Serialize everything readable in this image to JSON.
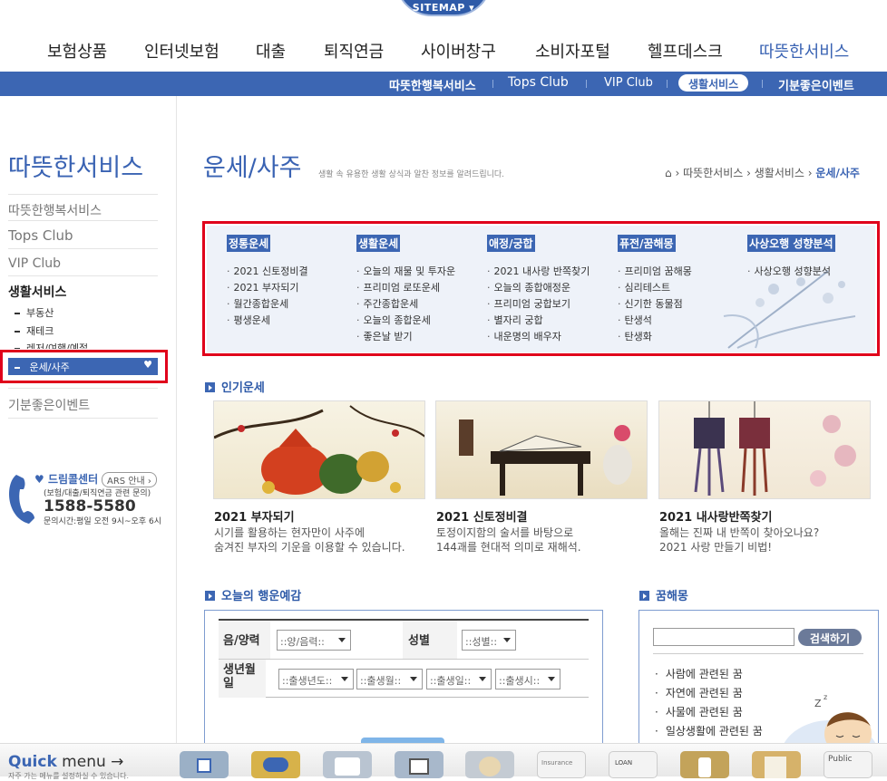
{
  "sitemap": "SITEMAP ▾",
  "gnb": [
    "보험상품",
    "인터넷보험",
    "대출",
    "퇴직연금",
    "사이버창구",
    "소비자포털",
    "헬프데스크",
    "따뜻한서비스"
  ],
  "subnav": [
    "따뜻한행복서비스",
    "Tops Club",
    "VIP Club",
    "생활서비스",
    "기분좋은이벤트"
  ],
  "lnb": {
    "title": "따뜻한서비스",
    "items": [
      "따뜻한행복서비스",
      "Tops Club",
      "VIP Club",
      "생활서비스"
    ],
    "subitems": [
      "부동산",
      "재테크",
      "레저/여행/예절"
    ],
    "active": "운세/사주",
    "last": "기분좋은이벤트"
  },
  "callcenter": {
    "title": "드림콜센터",
    "ars": "ARS 안내",
    "sub": "(보험/대출/퇴직연금 관련 문의)",
    "number": "1588-5580",
    "hours": "문의시간:평일 오전 9시~오후 6시"
  },
  "page": {
    "title": "운세/사주",
    "desc": "생활 속 유용한 생활 상식과 알찬 정보를 알려드립니다.",
    "breadcrumb": [
      "따뜻한서비스",
      "생활서비스",
      "운세/사주"
    ]
  },
  "categories": [
    {
      "name": "정통운세",
      "items": [
        "2021 신토정비결",
        "2021 부자되기",
        "월간종합운세",
        "평생운세"
      ]
    },
    {
      "name": "생활운세",
      "items": [
        "오늘의 재물 및 투자운",
        "프리미엄 로또운세",
        "주간종합운세",
        "오늘의 종합운세",
        "좋은날 받기"
      ]
    },
    {
      "name": "애정/궁합",
      "items": [
        "2021 내사랑 반쪽찾기",
        "오늘의 종합애정운",
        "프리미엄 궁합보기",
        "별자리 궁합",
        "내운명의 배우자"
      ]
    },
    {
      "name": "퓨전/꿈해몽",
      "items": [
        "프리미엄 꿈해몽",
        "심리테스트",
        "신기한 동물점",
        "탄생석",
        "탄생화"
      ]
    },
    {
      "name": "사상오행 성향분석",
      "items": [
        "사상오행 성향분석"
      ]
    }
  ],
  "popular": {
    "title": "인기운세",
    "cards": [
      {
        "title": "2021 부자되기",
        "desc1": "시기를 활용하는 현자만이 사주에",
        "desc2": "숨겨진 부자의 기운을 이용할 수 있습니다."
      },
      {
        "title": "2021 신토정비결",
        "desc1": "토정이지함의 술서를 바탕으로",
        "desc2": "144괘를 현대적 의미로 재해석."
      },
      {
        "title": "2021 내사랑반쪽찾기",
        "desc1": "올해는 진짜 내 반쪽이 찾아오나요?",
        "desc2": "2021 사랑 만들기 비법!"
      }
    ]
  },
  "fortune": {
    "title": "오늘의 행운예감",
    "lunar_label": "음/양력",
    "lunar_value": "::양/음력::",
    "gender_label": "성별",
    "gender_value": "::성별::",
    "birth_label": "생년월일",
    "birth_year": "::출생년도::",
    "birth_month": "::출생월::",
    "birth_day": "::출생일::",
    "birth_hour": "::출생시::"
  },
  "dream": {
    "title": "꿈해몽",
    "search_btn": "검색하기",
    "items": [
      "사람에 관련된 꿈",
      "자연에 관련된 꿈",
      "사물에 관련된 꿈",
      "일상생활에 관련된 꿈"
    ]
  },
  "quick": {
    "title_bold": "Quick",
    "title_rest": " menu →",
    "sub": "자주 가는 메뉴를 설정하실 수 있습니다.",
    "labels": [
      "Insurance",
      "LOAN",
      "Public"
    ]
  },
  "colors": {
    "brand": "#3c66b3",
    "highlight": "#e0001b",
    "panel": "#eef2f9"
  }
}
